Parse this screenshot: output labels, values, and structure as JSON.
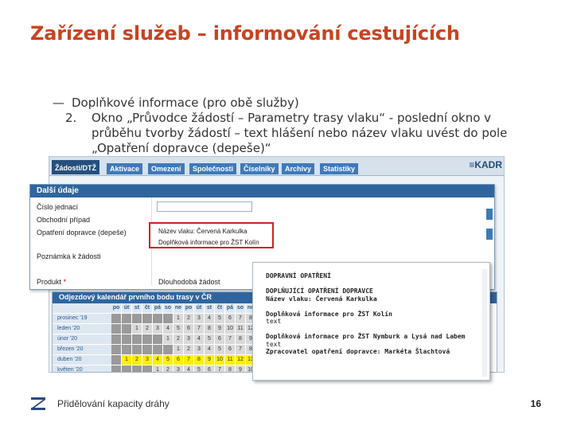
{
  "slide": {
    "title": "Zařízení služeb – informování cestujících"
  },
  "bullets": {
    "dash": "—",
    "line1": "Doplňkové informace (pro obě služby)",
    "item_number": "2.",
    "item_lines": [
      "Okno „Průvodce žádostí – Parametry trasy vlaku“ - poslední okno v",
      "průběhu tvorby žádostí – text hlášení nebo název vlaku uvést do pole",
      "„Opatření dopravce (depeše)“"
    ]
  },
  "app": {
    "menu_tabs": [
      "Žádosti/DTŽ",
      "Aktivace",
      "Omezení",
      "Společnosti",
      "Číselníky",
      "Archivy",
      "Statistiky"
    ],
    "brand": "≡KADR"
  },
  "form": {
    "header": "Další údaje",
    "fields": [
      {
        "label": "Číslo jednací"
      },
      {
        "label": "Obchodní případ"
      },
      {
        "label": "Opatření dopravce (depeše)"
      },
      {
        "label": "Poznámka k žádosti"
      },
      {
        "label": "Produkt",
        "required": "*",
        "value": "Dlouhodobá žádost"
      }
    ]
  },
  "highlight": {
    "line1": "Název vlaku: Červená Karkulka",
    "line2": "Doplňková informace pro ŽST Kolín"
  },
  "calendar": {
    "header": "Odjezdový kalendář prvního bodu trasy v ČR",
    "day_headers": [
      "po",
      "út",
      "st",
      "čt",
      "pá",
      "so",
      "ne",
      "po",
      "út",
      "st",
      "čt",
      "pá",
      "so",
      "ne"
    ],
    "months": [
      {
        "name": "prosinec '19",
        "cells": [
          "",
          "",
          "",
          "",
          "",
          "",
          "1",
          "2",
          "3",
          "4",
          "5",
          "6",
          "7",
          "8"
        ]
      },
      {
        "name": "leden '20",
        "cells": [
          "",
          "",
          "1",
          "2",
          "3",
          "4",
          "5",
          "6",
          "7",
          "8",
          "9",
          "10",
          "11",
          "12"
        ]
      },
      {
        "name": "únor '20",
        "cells": [
          "",
          "",
          "",
          "",
          "",
          "1",
          "2",
          "3",
          "4",
          "5",
          "6",
          "7",
          "8",
          "9"
        ]
      },
      {
        "name": "březen '20",
        "cells": [
          "",
          "",
          "",
          "",
          "",
          "",
          "1",
          "2",
          "3",
          "4",
          "5",
          "6",
          "7",
          "8"
        ]
      },
      {
        "name": "duben '20",
        "cells": [
          "",
          "1",
          "2",
          "3",
          "4",
          "5",
          "6",
          "7",
          "8",
          "9",
          "10",
          "11",
          "12",
          "13"
        ]
      },
      {
        "name": "květen '20",
        "cells": [
          "",
          "",
          "",
          "",
          "1",
          "2",
          "3",
          "4",
          "5",
          "6",
          "7",
          "8",
          "9",
          "10"
        ]
      }
    ]
  },
  "popup": {
    "lines": [
      "DOPRAVNÍ OPATŘENÍ",
      "",
      "DOPLŇUJÍCÍ OPATŘENÍ DOPRAVCE",
      "Název vlaku: Červená Karkulka",
      "",
      "Doplňková informace pro ŽST Kolín",
      "text",
      "",
      "Doplňková informace pro ŽST Nymburk a Lysá nad Labem",
      "text",
      "Zpracovatel opatření dopravce: Markéta Šlachtová"
    ]
  },
  "footer": {
    "text": "Přidělování kapacity dráhy",
    "page": "16"
  },
  "colors": {
    "title": "#c8441f",
    "accent_blue": "#2e659f",
    "highlight_red": "#d42020",
    "calendar_yellow": "#ffee00"
  }
}
